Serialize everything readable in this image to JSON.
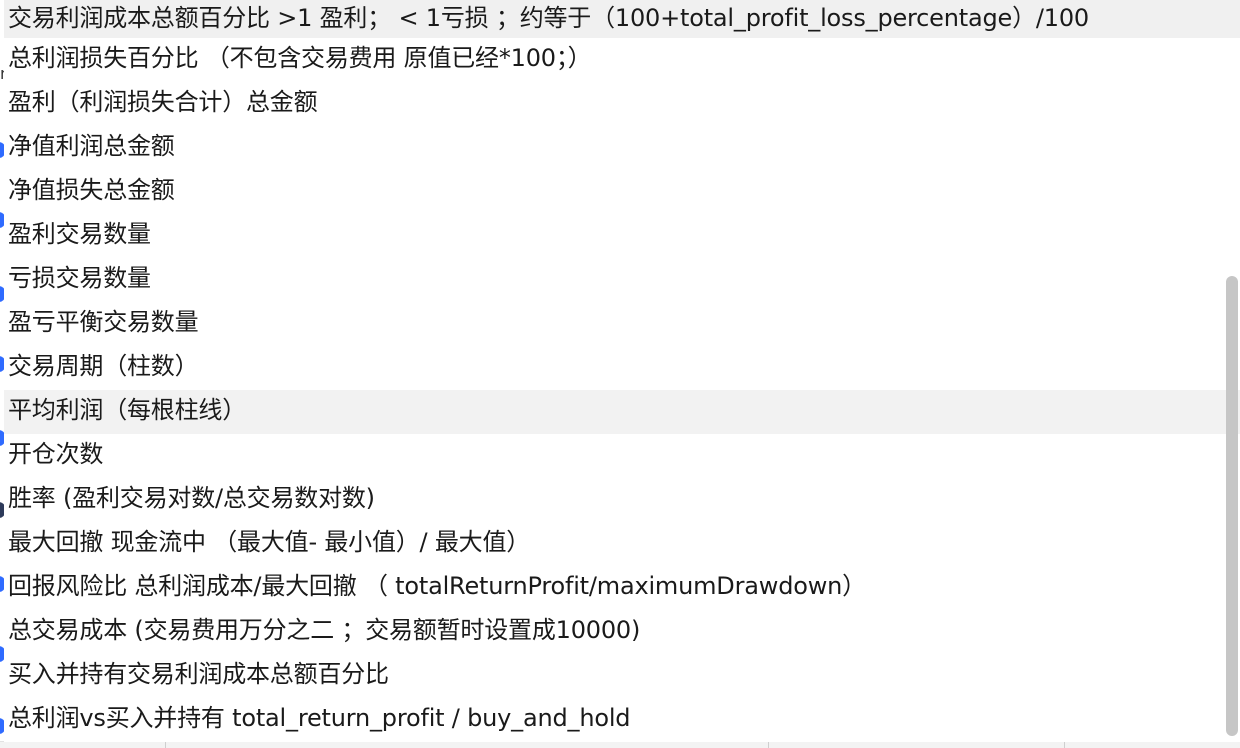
{
  "dropdown": {
    "options": [
      "交易利润成本总额百分比 >1 盈利； < 1亏损 ；约等于（100+total_profit_loss_percentage）/100",
      "总利润损失百分比 （不包含交易费用 原值已经*100；）",
      "盈利（利润损失合计）总金额",
      "净值利润总金额",
      "净值损失总金额",
      "盈利交易数量",
      "亏损交易数量",
      "盈亏平衡交易数量",
      "交易周期（柱数）",
      "平均利润（每根柱线）",
      "开仓次数",
      "胜率 (盈利交易对数/总交易数对数)",
      "最大回撤 现金流中 （最大值- 最小值）/ 最大值）",
      "回报风险比 总利润成本/最大回撤 （ totalReturnProfit/maximumDrawdown）",
      "总交易成本 (交易费用万分之二 ；交易额暂时设置成10000)",
      "买入并持有交易利润成本总额百分比",
      "总利润vs买入并持有 total_return_profit / buy_and_hold"
    ],
    "hovered_index": 9
  },
  "background": {
    "partial_glyph": "n"
  },
  "colors": {
    "marker_blue": "#2f6bff",
    "marker_dark": "#2d3a5a",
    "hover_bg": "#f2f2f2",
    "scrollbar_thumb": "#c6c6c6"
  }
}
